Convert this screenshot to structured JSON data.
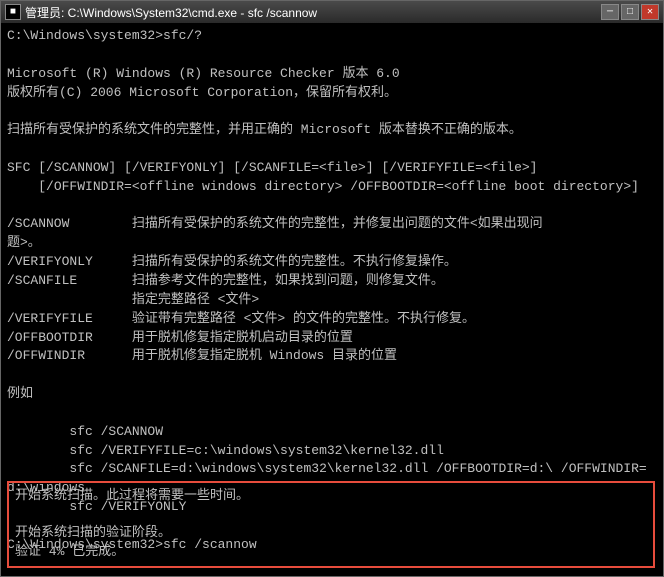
{
  "titleBar": {
    "icon": "■",
    "title": "管理员: C:\\Windows\\System32\\cmd.exe - sfc /scannow",
    "minimize": "─",
    "maximize": "□",
    "close": "✕"
  },
  "console": {
    "mainText": "C:\\Windows\\system32>sfc/?\n\nMicrosoft (R) Windows (R) Resource Checker 版本 6.0\n版权所有(C) 2006 Microsoft Corporation，保留所有权利。\n\n扫描所有受保护的系统文件的完整性，并用正确的 Microsoft 版本替换不正确的版本。\n\nSFC [/SCANNOW] [/VERIFYONLY] [/SCANFILE=<file>] [/VERIFYFILE=<file>]\n    [/OFFWINDIR=<offline windows directory> /OFFBOOTDIR=<offline boot directory>]\n\n/SCANNOW        扫描所有受保护的系统文件的完整性，并修复出问题的文件<如果出现问\n题>。\n/VERIFYONLY     扫描所有受保护的系统文件的完整性。不执行修复操作。\n/SCANFILE       扫描参考文件的完整性，如果找到问题，则修复文件。\n                指定完整路径 <文件>\n/VERIFYFILE     验证带有完整路径 <文件> 的文件的完整性。不执行修复。\n/OFFBOOTDIR     用于脱机修复指定脱机启动目录的位置\n/OFFWINDIR      用于脱机修复指定脱机 Windows 目录的位置\n\n例如\n\n        sfc /SCANNOW\n        sfc /VERIFYFILE=c:\\windows\\system32\\kernel32.dll\n        sfc /SCANFILE=d:\\windows\\system32\\kernel32.dll /OFFBOOTDIR=d:\\ /OFFWINDIR=d:\\windows\n        sfc /VERIFYONLY\n\nC:\\Windows\\system32>sfc /scannow\n",
    "highlightText": "开始系统扫描。此过程将需要一些时间。\n\n开始系统扫描的验证阶段。\n验证 4% 已完成。"
  }
}
